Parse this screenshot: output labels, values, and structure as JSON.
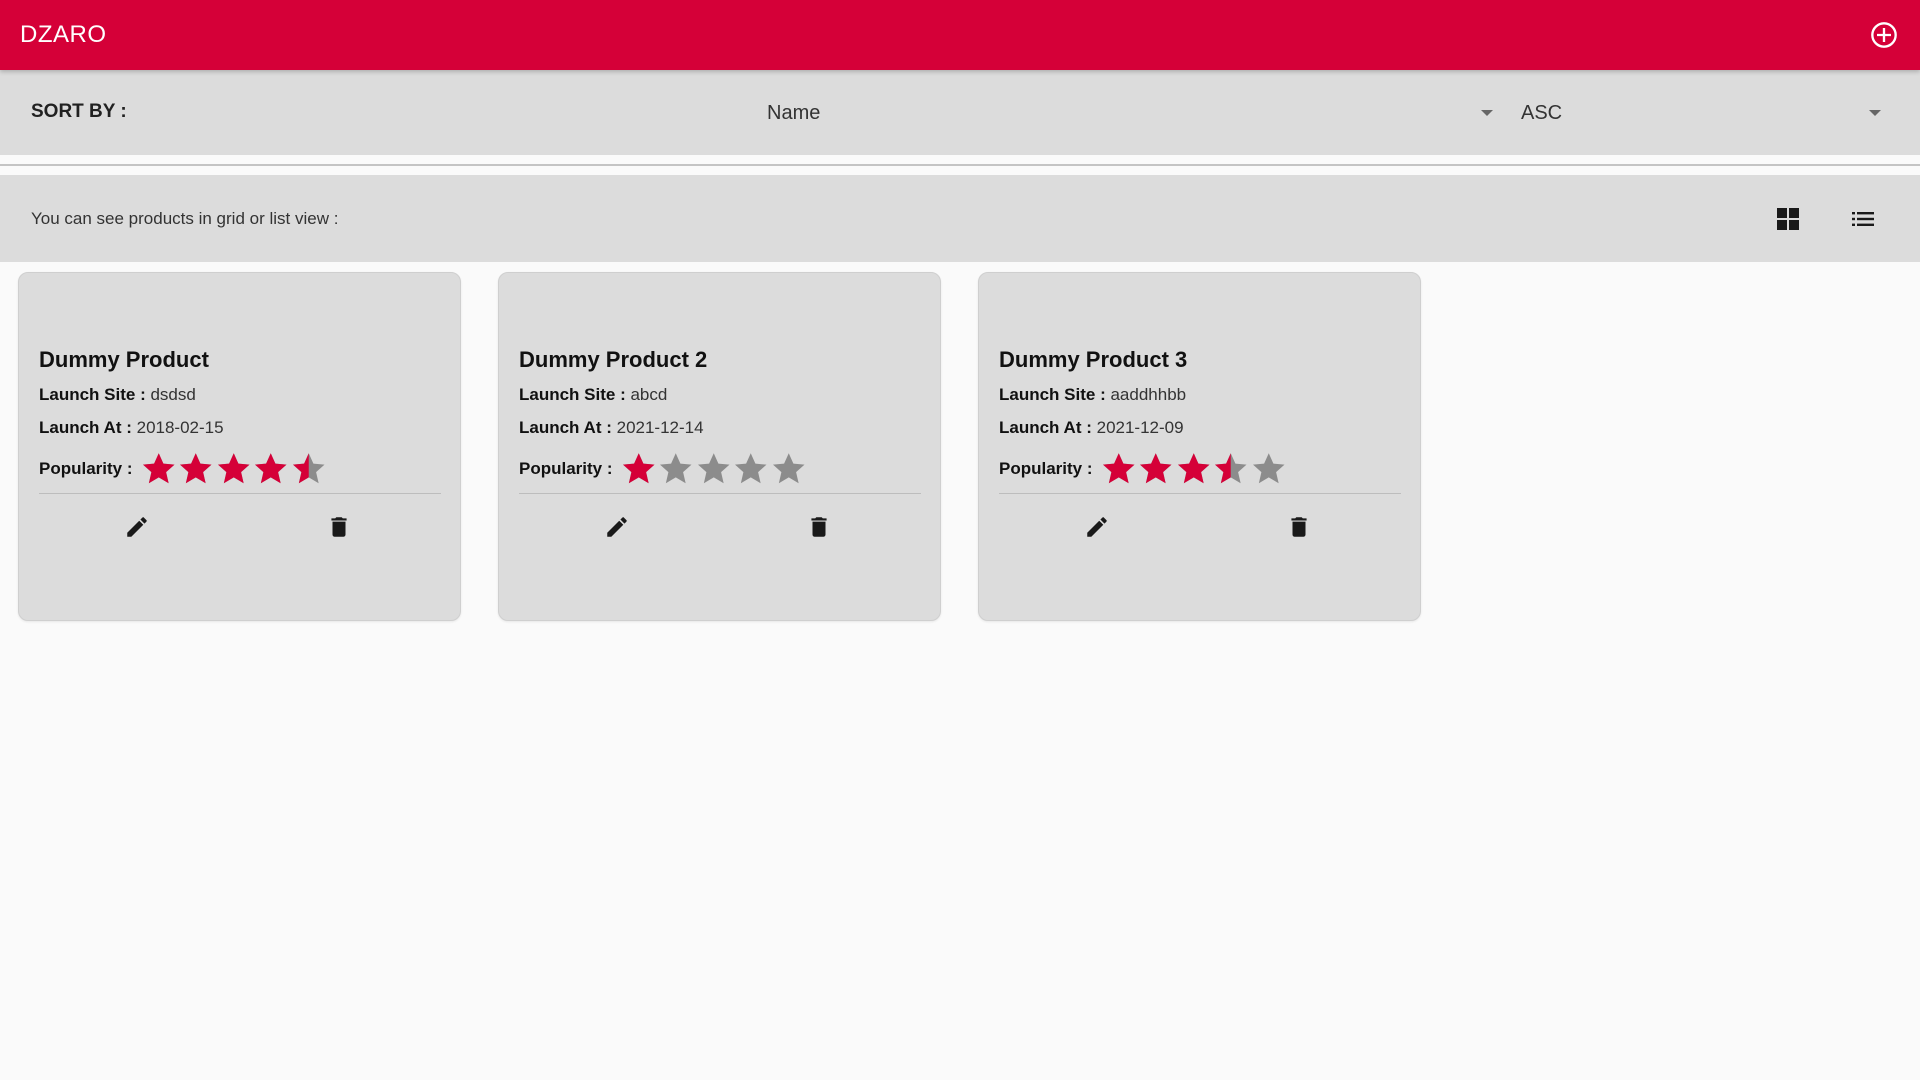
{
  "appbar": {
    "brand": "DZARO",
    "add_icon": "add-circle-outline-icon",
    "color": "#d50038"
  },
  "sort": {
    "label": "SORT BY :",
    "field_value": "Name",
    "order_value": "ASC"
  },
  "view": {
    "hint": "You can see products in grid or list view :",
    "grid_icon": "grid-view-icon",
    "list_icon": "list-view-icon"
  },
  "labels": {
    "launch_site": "Launch Site :",
    "launch_at": "Launch At :",
    "popularity": "Popularity :"
  },
  "colors": {
    "star_filled": "#d50038",
    "star_empty": "#8c8c8c"
  },
  "products": [
    {
      "name": "Dummy Product",
      "launch_site": "dsdsd",
      "launch_at": "2018-02-15",
      "popularity": 4.5
    },
    {
      "name": "Dummy Product 2",
      "launch_site": "abcd",
      "launch_at": "2021-12-14",
      "popularity": 1
    },
    {
      "name": "Dummy Product 3",
      "launch_site": "aaddhhbb",
      "launch_at": "2021-12-09",
      "popularity": 3.5
    }
  ]
}
